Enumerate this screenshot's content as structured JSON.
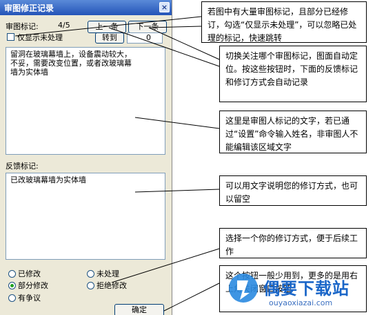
{
  "dialog": {
    "title": "审图修正记录",
    "close_glyph": "×",
    "review_mark_label": "审图标记:",
    "page_counter": "4/5",
    "prev_button": "上一条",
    "next_button": "下一条",
    "only_unprocessed_label": "仅显示未处理",
    "jump_button": "转到",
    "jump_value": "0",
    "review_text": "留洞在玻璃幕墙上，设备震动较大，\n不妥，需要改变位置，或者改玻璃幕\n墙为实体墙",
    "feedback_label": "反馈标记:",
    "feedback_text": "已改玻璃幕墙为实体墙",
    "options": {
      "modified": "已修改",
      "unprocessed": "未处理",
      "partially_modified": "部分修改",
      "rejected": "拒绝修改",
      "disputed": "有争议",
      "selected": "partially_modified"
    },
    "ok_button": "确定"
  },
  "callouts": {
    "c1": "若图中有大量审图标记，且部分已经修订，勾选“仅显示未处理”，可以忽略已处理的标记，快速跳转",
    "c2": "切换关注哪个审图标记，图面自动定位。按这些按钮时，下面的反馈标记和修订方式会自动记录",
    "c3": "这里是审图人标记的文字，若已通过“设置”命令输入姓名，非审图人不能编辑该区域文字",
    "c4": "可以用文字说明您的修订方式，也可以留空",
    "c5": "选择一个你的修订方式，便于后续工作",
    "c6": "这个按钮一般少用到，更多的是用右上角关闭窗口按钮"
  },
  "watermark": {
    "text": "偶要下载站",
    "url": "ouyaoxiazai.com",
    "color": "#1a66c8"
  }
}
